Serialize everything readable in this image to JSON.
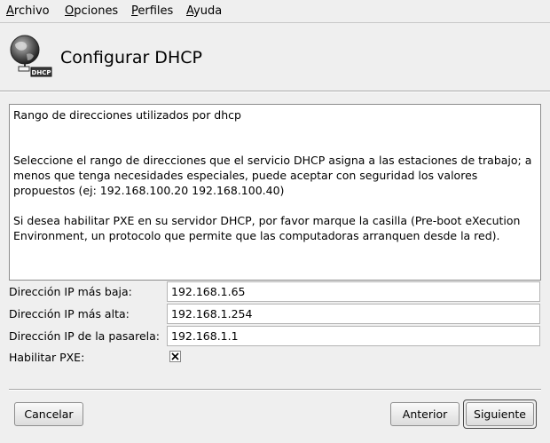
{
  "menubar": {
    "items": [
      {
        "mnemonic": "A",
        "rest": "rchivo"
      },
      {
        "mnemonic": "O",
        "rest": "pciones"
      },
      {
        "mnemonic": "P",
        "rest": "erfiles"
      },
      {
        "mnemonic": "A",
        "rest": "yuda"
      }
    ]
  },
  "header": {
    "title": "Configurar DHCP",
    "icon_badge": "DHCP"
  },
  "info": {
    "heading": "Rango de direcciones utilizados por dhcp",
    "paragraph1": "Seleccione el rango de direcciones que el servicio DHCP asigna a las estaciones de trabajo; a menos que tenga necesidades especiales, puede aceptar con seguridad los valores propuestos (ej: 192.168.100.20 192.168.100.40)",
    "paragraph2": "Si desea habilitar PXE en su servidor DHCP, por favor marque la casilla (Pre-boot eXecution Environment, un protocolo que permite que las computadoras arranquen desde la red)."
  },
  "form": {
    "low_ip_label": "Dirección IP más baja:",
    "low_ip_value": "192.168.1.65",
    "high_ip_label": "Dirección IP más alta:",
    "high_ip_value": "192.168.1.254",
    "gateway_label": "Dirección IP de la pasarela:",
    "gateway_value": "192.168.1.1",
    "pxe_label": "Habilitar PXE:",
    "pxe_checked": true
  },
  "buttons": {
    "cancel": "Cancelar",
    "back": "Anterior",
    "next": "Siguiente"
  }
}
